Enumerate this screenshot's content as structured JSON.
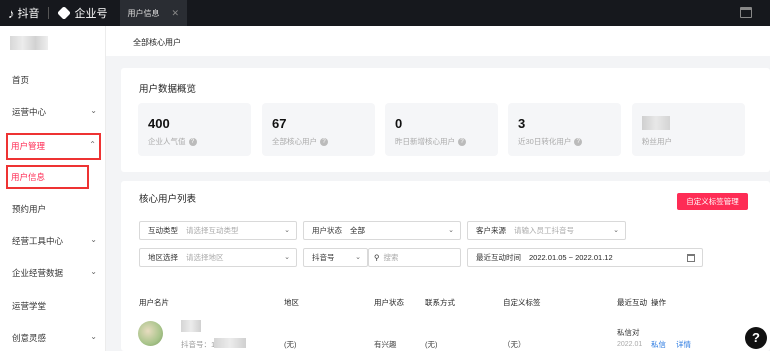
{
  "topbar": {
    "douyin_label": "抖音",
    "qiye_label": "企业号",
    "tab_label": "用户信息",
    "tab_close": "✕"
  },
  "sidebar": {
    "items": [
      {
        "label": "首页"
      },
      {
        "label": "运营中心",
        "chev": "⌄"
      },
      {
        "label": "用户管理",
        "chev": "⌃"
      },
      {
        "label": "用户信息"
      },
      {
        "label": "预约用户"
      },
      {
        "label": "经营工具中心",
        "chev": "⌄"
      },
      {
        "label": "企业经营数据",
        "chev": "⌄"
      },
      {
        "label": "运营学堂"
      },
      {
        "label": "创意灵感",
        "chev": "⌄"
      }
    ]
  },
  "breadcrumb": "全部核心用户",
  "overview": {
    "title": "用户数据概览",
    "stats": [
      {
        "value": "400",
        "label": "企业人气值"
      },
      {
        "value": "67",
        "label": "全部核心用户"
      },
      {
        "value": "0",
        "label": "昨日新增核心用户"
      },
      {
        "value": "3",
        "label": "近30日转化用户"
      },
      {
        "value": "",
        "label": "粉丝用户"
      }
    ]
  },
  "list": {
    "title": "核心用户列表",
    "custom_tag_button": "自定义标签管理",
    "filters": {
      "interaction_type": {
        "label": "互动类型",
        "placeholder": "请选择互动类型"
      },
      "user_status": {
        "label": "用户状态",
        "value": "全部"
      },
      "customer_source": {
        "label": "客户来源",
        "placeholder": "请输入员工抖音号"
      },
      "region": {
        "label": "地区选择",
        "placeholder": "请选择地区"
      },
      "douyin_id": {
        "label": "抖音号"
      },
      "search": {
        "placeholder": "搜索"
      },
      "recent_time": {
        "label": "最近互动时间",
        "value": "2022.01.05 ~ 2022.01.12"
      }
    },
    "columns": [
      "用户名片",
      "地区",
      "用户状态",
      "联系方式",
      "自定义标签",
      "最近互动",
      "操作"
    ],
    "rows": [
      {
        "douyin_prefix": "抖音号：1",
        "region": "(无)",
        "status": "有兴趣",
        "contact": "(无)",
        "tag": "（无）",
        "recent_line1": "私信对",
        "recent_line2": "2022.01",
        "action_msg": "私信",
        "action_detail": "详情"
      }
    ]
  },
  "help": "?"
}
